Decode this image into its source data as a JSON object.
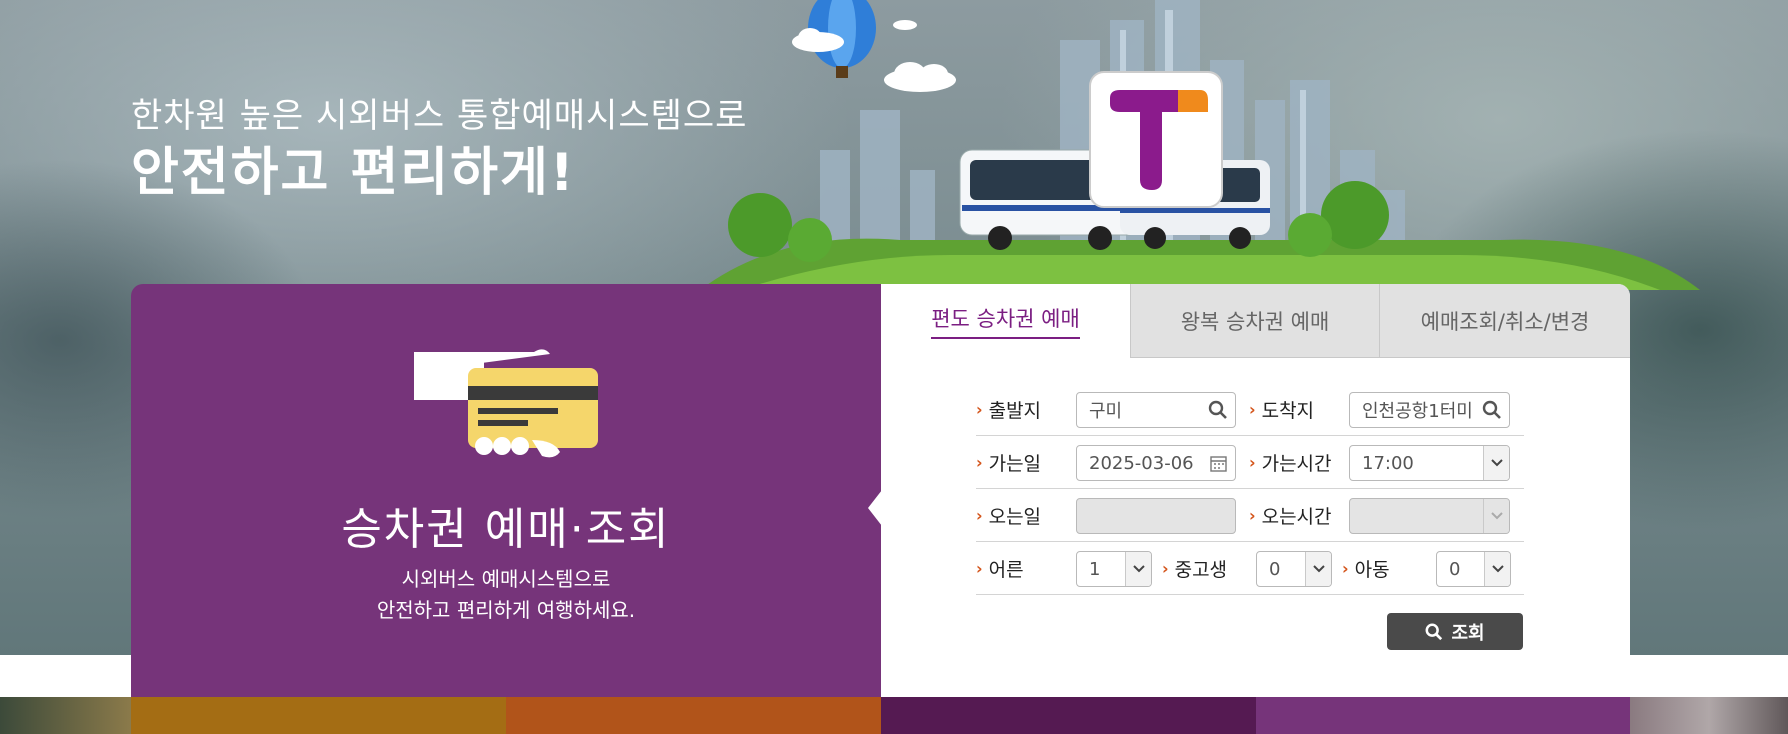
{
  "hero": {
    "slogan_sub": "한차원 높은 시외버스 통합예매시스템으로",
    "slogan_main": "안전하고 편리하게!"
  },
  "left_panel": {
    "icon": "card-in-hand-icon",
    "title": "승차권 예매·조회",
    "desc_line1": "시외버스 예매시스템으로",
    "desc_line2": "안전하고 편리하게 여행하세요."
  },
  "tabs": [
    {
      "label": "편도 승차권 예매",
      "active": true
    },
    {
      "label": "왕복 승차권 예매",
      "active": false
    },
    {
      "label": "예매조회/취소/변경",
      "active": false
    }
  ],
  "form": {
    "departure_label": "출발지",
    "departure_value": "구미",
    "arrival_label": "도착지",
    "arrival_value": "인천공항1터미",
    "go_date_label": "가는일",
    "go_date_value": "2025-03-06",
    "go_time_label": "가는시간",
    "go_time_value": "17:00",
    "return_date_label": "오는일",
    "return_date_value": "",
    "return_time_label": "오는시간",
    "return_time_value": "",
    "adult_label": "어른",
    "adult_value": "1",
    "youth_label": "중고생",
    "youth_value": "0",
    "child_label": "아동",
    "child_value": "0",
    "search_button": "조회"
  },
  "colors": {
    "purple": "#76347a",
    "tab_active": "#7b1e82",
    "arrow": "#d4541a",
    "button": "#4a4a4a"
  }
}
